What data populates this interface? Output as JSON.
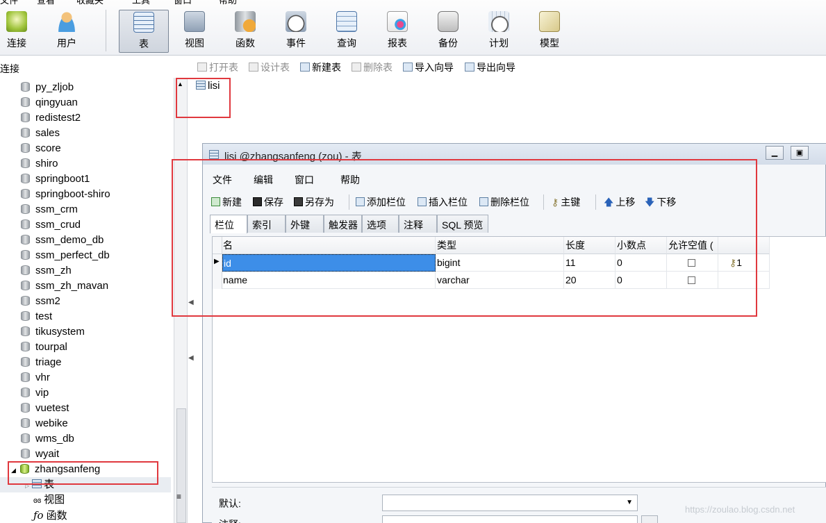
{
  "menu_strip": [
    "文件",
    "查看",
    "收藏夹",
    "工具",
    "窗口",
    "帮助"
  ],
  "toolbar": {
    "buttons": [
      {
        "label": "连接",
        "icon": "connect-icon",
        "active": false
      },
      {
        "label": "用户",
        "icon": "user-icon",
        "active": false
      },
      {
        "label": "表",
        "icon": "table-icon",
        "active": true
      },
      {
        "label": "视图",
        "icon": "view-icon",
        "active": false
      },
      {
        "label": "函数",
        "icon": "function-icon",
        "active": false
      },
      {
        "label": "事件",
        "icon": "event-icon",
        "active": false
      },
      {
        "label": "查询",
        "icon": "query-icon",
        "active": false
      },
      {
        "label": "报表",
        "icon": "report-icon",
        "active": false
      },
      {
        "label": "备份",
        "icon": "backup-icon",
        "active": false
      },
      {
        "label": "计划",
        "icon": "schedule-icon",
        "active": false
      },
      {
        "label": "模型",
        "icon": "model-icon",
        "active": false
      }
    ]
  },
  "object_toolbar": {
    "connection_label": "连接",
    "buttons": [
      {
        "label": "打开表",
        "enabled": false
      },
      {
        "label": "设计表",
        "enabled": false
      },
      {
        "label": "新建表",
        "enabled": true
      },
      {
        "label": "删除表",
        "enabled": false
      },
      {
        "label": "导入向导",
        "enabled": true
      },
      {
        "label": "导出向导",
        "enabled": true
      }
    ]
  },
  "tree": {
    "databases": [
      "py_zljob",
      "qingyuan",
      "redistest2",
      "sales",
      "score",
      "shiro",
      "springboot1",
      "springboot-shiro",
      "ssm_crm",
      "ssm_crud",
      "ssm_demo_db",
      "ssm_perfect_db",
      "ssm_zh",
      "ssm_zh_mavan",
      "ssm2",
      "test",
      "tikusystem",
      "tourpal",
      "triage",
      "vhr",
      "vip",
      "vuetest",
      "webike",
      "wms_db",
      "wyait"
    ],
    "active_database": "zhangsanfeng",
    "children": [
      "表",
      "视图",
      "函数"
    ],
    "child_icons": [
      "table-icon",
      "view-icon",
      "function-icon"
    ]
  },
  "object_area": {
    "tables": [
      "lisi"
    ]
  },
  "designer": {
    "title": "lisi @zhangsanfeng (zou) - 表",
    "menu": [
      "文件",
      "编辑",
      "窗口",
      "帮助"
    ],
    "toolbar": [
      "新建",
      "保存",
      "另存为",
      "添加栏位",
      "插入栏位",
      "删除栏位",
      "主键",
      "上移",
      "下移"
    ],
    "tabs": [
      "栏位",
      "索引",
      "外键",
      "触发器",
      "选项",
      "注释",
      "SQL 预览"
    ],
    "active_tab": "栏位",
    "columns": [
      "名",
      "类型",
      "长度",
      "小数点",
      "允许空值 ("
    ],
    "rows": [
      {
        "name": "id",
        "type": "bigint",
        "length": "11",
        "decimals": "0",
        "nullable": false,
        "key": "1"
      },
      {
        "name": "name",
        "type": "varchar",
        "length": "20",
        "decimals": "0",
        "nullable": false,
        "key": ""
      }
    ],
    "props": {
      "default_label": "默认:",
      "comment_label": "注释:"
    }
  },
  "watermark": "https://zoulao.blog.csdn.net",
  "colors": {
    "highlight": "#e0383e",
    "selection": "#3d8ee8",
    "active_db": "#7dad28"
  }
}
